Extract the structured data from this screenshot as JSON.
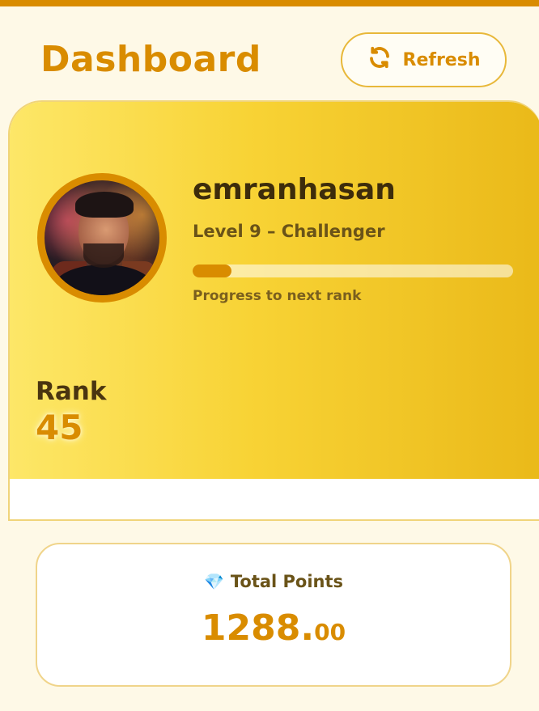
{
  "header": {
    "title": "Dashboard",
    "refresh_label": "Refresh"
  },
  "profile": {
    "username": "emranhasan",
    "level_text": "Level 9 – Challenger",
    "progress_label": "Progress to next rank",
    "progress_fraction": 0.12,
    "rank_label": "Rank",
    "rank_value": "45"
  },
  "points": {
    "icon": "gem-icon",
    "label": "Total Points",
    "value_int": "1288.",
    "value_dec": "00"
  },
  "colors": {
    "accent": "#d98c00",
    "hero_gradient_start": "#fde768",
    "hero_gradient_end": "#eab919",
    "page_bg": "#fef9e7"
  }
}
